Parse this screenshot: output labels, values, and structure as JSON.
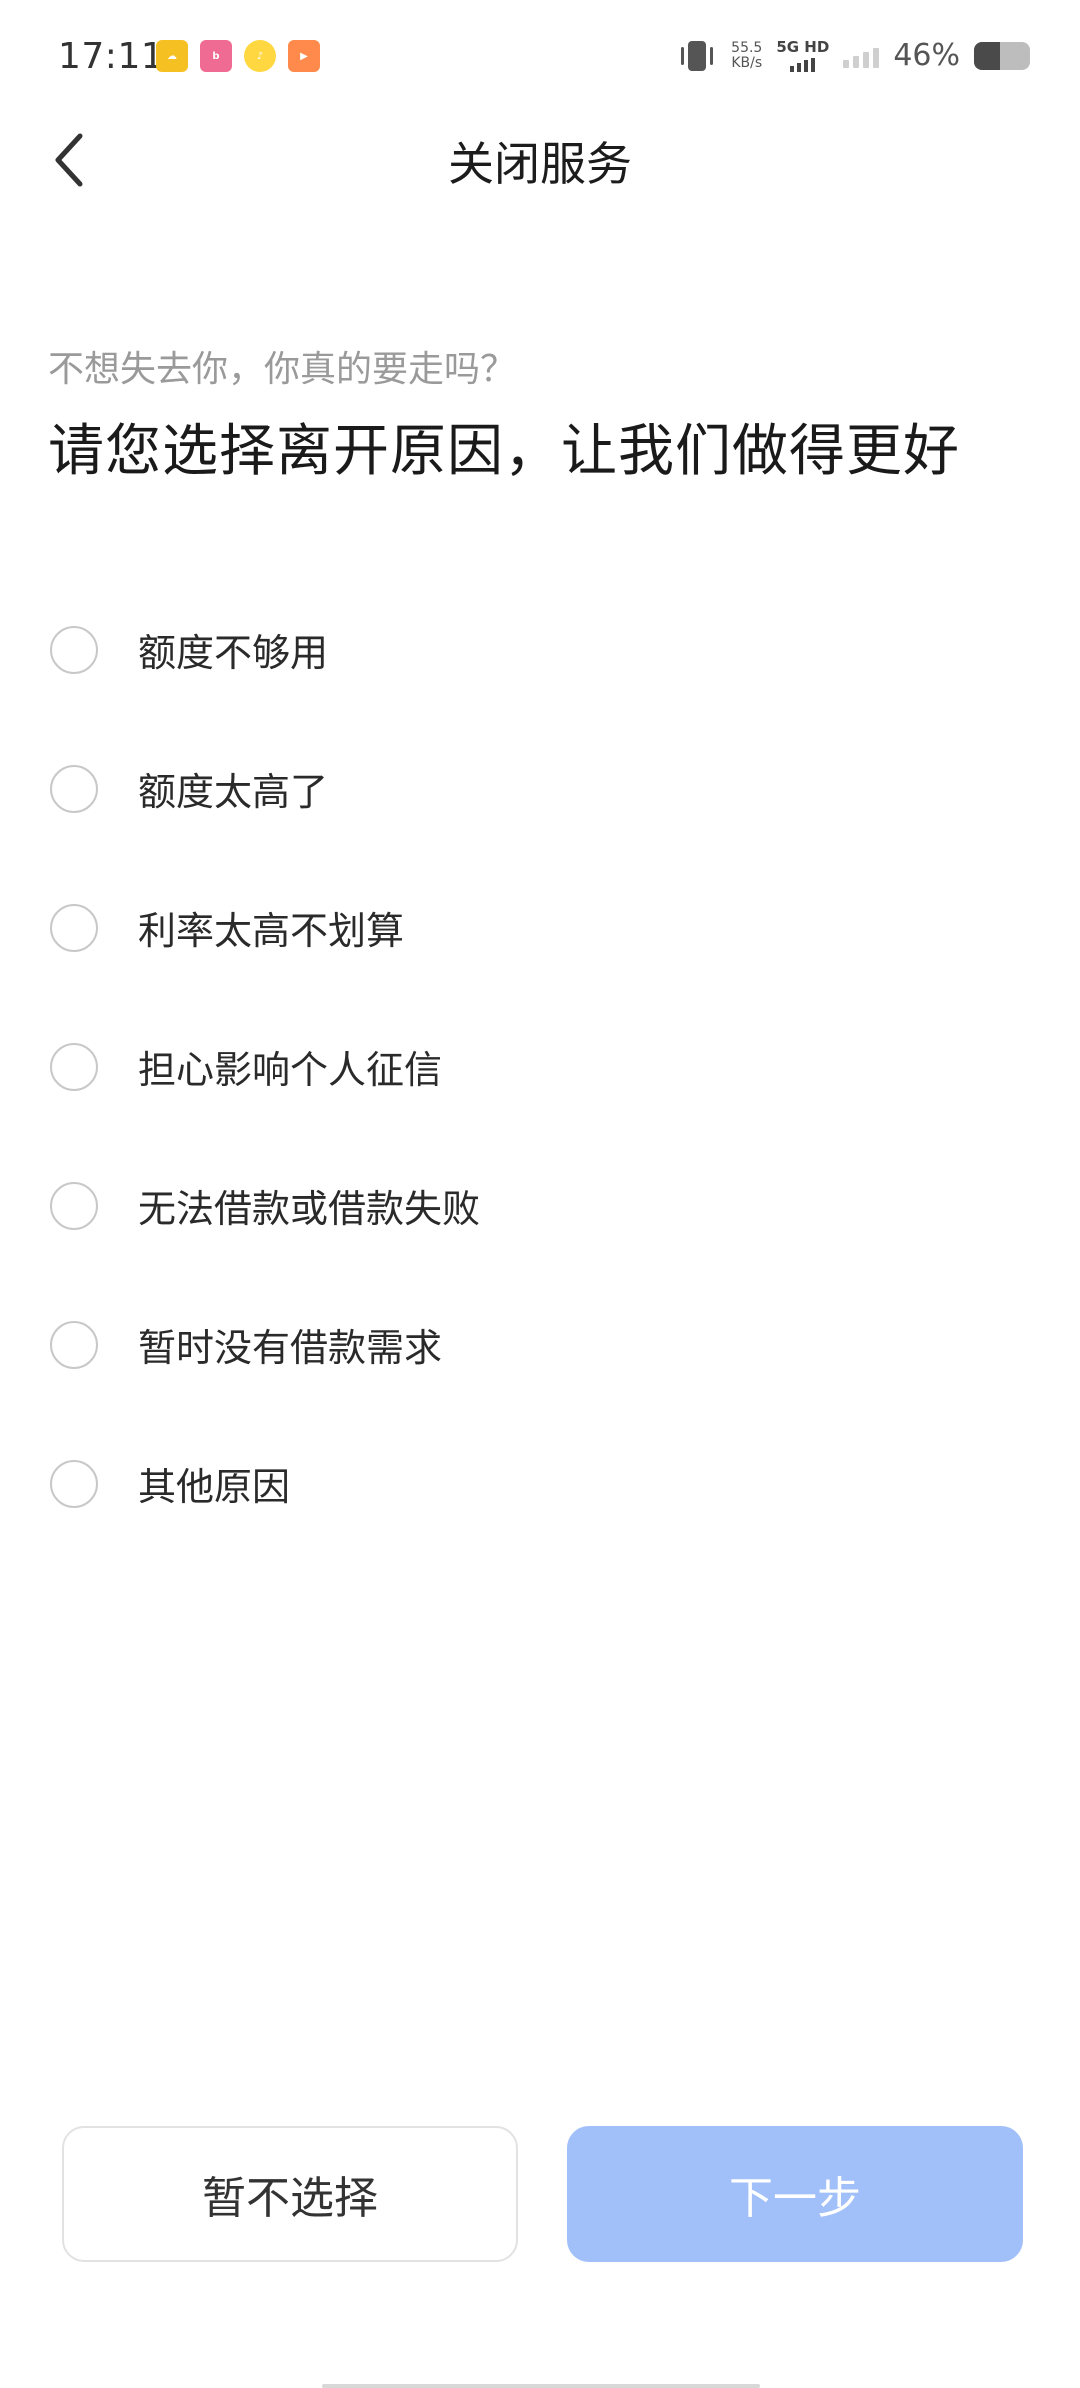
{
  "status_bar": {
    "time": "17:11",
    "notification_icons": [
      "weather-cloud-icon",
      "bilibili-app-icon",
      "music-app-icon",
      "video-app-icon"
    ],
    "net_speed_value": "55.5",
    "net_speed_unit": "KB/s",
    "network_type": "5G HD",
    "battery_text": "46%",
    "battery_level": 0.46
  },
  "nav": {
    "title": "关闭服务",
    "back_icon": "chevron-left-icon"
  },
  "header": {
    "subtitle": "不想失去你，你真的要走吗？",
    "headline": "请您选择离开原因，让我们做得更好"
  },
  "options": [
    {
      "label": "额度不够用",
      "selected": false
    },
    {
      "label": "额度太高了",
      "selected": false
    },
    {
      "label": "利率太高不划算",
      "selected": false
    },
    {
      "label": "担心影响个人征信",
      "selected": false
    },
    {
      "label": "无法借款或借款失败",
      "selected": false
    },
    {
      "label": "暂时没有借款需求",
      "selected": false
    },
    {
      "label": "其他原因",
      "selected": false
    }
  ],
  "buttons": {
    "skip_label": "暂不选择",
    "next_label": "下一步"
  },
  "colors": {
    "next_button_disabled": "#a1bff9",
    "radio_border": "#c8c8c8",
    "subtitle_text": "#9a9a9a"
  }
}
